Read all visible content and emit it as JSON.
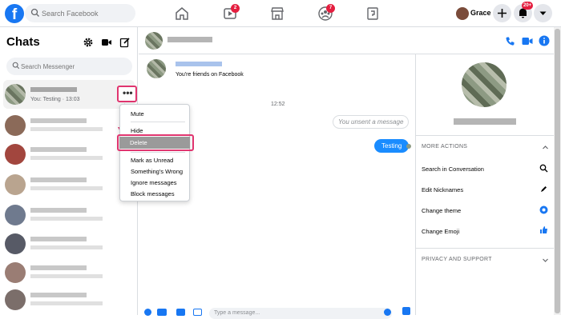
{
  "topbar": {
    "logo": "f",
    "search_placeholder": "Search Facebook",
    "nav": [
      {
        "icon": "home-icon"
      },
      {
        "icon": "watch-icon",
        "badge": "2"
      },
      {
        "icon": "marketplace-icon"
      },
      {
        "icon": "groups-icon",
        "badge": "7"
      },
      {
        "icon": "gaming-icon"
      }
    ],
    "profile_name": "Grace",
    "notifications_badge": "20+"
  },
  "sidebar": {
    "title": "Chats",
    "search_placeholder": "Search Messenger",
    "active_chat": {
      "preview": "You: Testing · 13:03"
    },
    "more_button": "•••"
  },
  "context_menu": {
    "items": [
      "Mute",
      "Hide",
      "Delete",
      "Mark as Unread",
      "Something's Wrong",
      "Ignore messages",
      "Block messages"
    ]
  },
  "conversation": {
    "friends_note": "You're friends on Facebook",
    "timestamp": "12:52",
    "unsent": "You unsent a message",
    "sent": "Testing",
    "composer_placeholder": "Type a message..."
  },
  "info_panel": {
    "more_actions_title": "MORE ACTIONS",
    "actions": [
      {
        "label": "Search in Conversation",
        "icon": "search-icon"
      },
      {
        "label": "Edit Nicknames",
        "icon": "edit-icon"
      },
      {
        "label": "Change theme",
        "icon": "theme-icon"
      },
      {
        "label": "Change Emoji",
        "icon": "thumbs-up-icon"
      }
    ],
    "privacy_title": "PRIVACY AND SUPPORT"
  },
  "colors": {
    "accent": "#1877f2",
    "highlight": "#e0356f",
    "sent_bubble": "#1a8cff"
  }
}
